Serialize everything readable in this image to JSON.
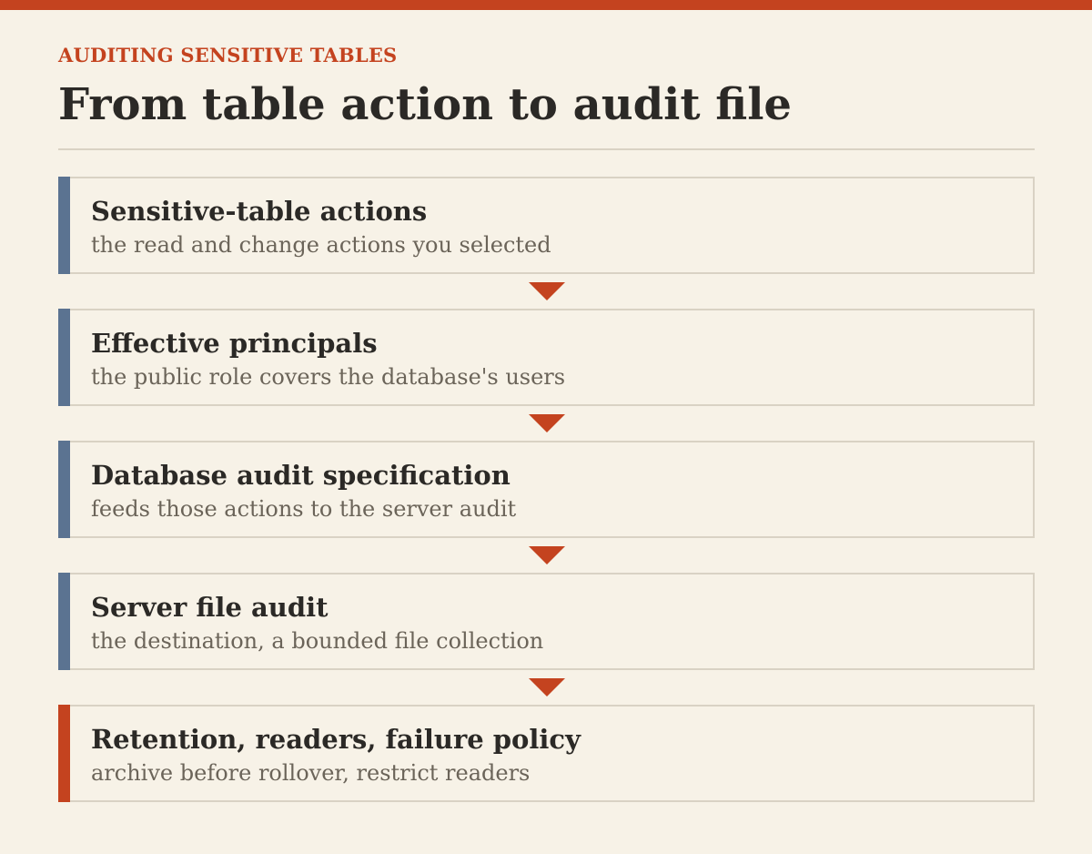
{
  "header": {
    "eyebrow": "AUDITING SENSITIVE TABLES",
    "title": "From table action to audit file"
  },
  "colors": {
    "accent": "#c4431f",
    "step_bar": "#5b7391",
    "background": "#f7f2e7",
    "text": "#2b2926",
    "muted_text": "#6b6459",
    "border": "#d9d2c4"
  },
  "steps": [
    {
      "title": "Sensitive-table actions",
      "description": "the read and change actions you selected"
    },
    {
      "title": "Effective principals",
      "description": "the public role covers the database's users"
    },
    {
      "title": "Database audit specification",
      "description": "feeds those actions to the server audit"
    },
    {
      "title": "Server file audit",
      "description": "the destination, a bounded file collection"
    },
    {
      "title": "Retention, readers, failure policy",
      "description": "archive before rollover, restrict readers"
    }
  ],
  "connector_icon": "down-triangle-arrow"
}
